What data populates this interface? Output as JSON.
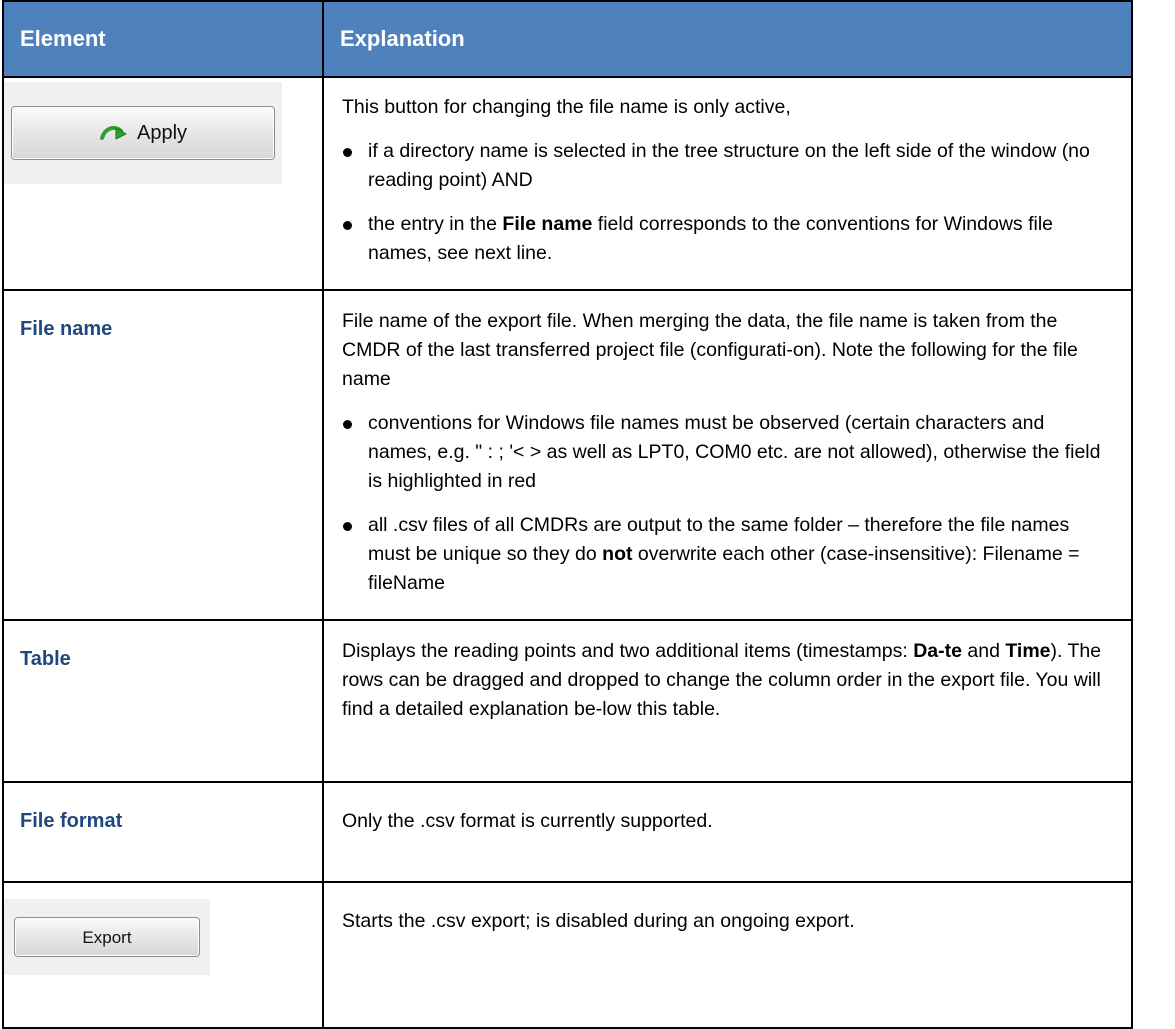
{
  "table": {
    "headers": {
      "element": "Element",
      "explanation": "Explanation"
    },
    "rows": [
      {
        "element_image": {
          "kind": "button",
          "label": "Apply",
          "icon": "green-curved-arrow-icon"
        },
        "intro": "This button for changing the file name is only active,",
        "bullets": [
          {
            "text": "if a directory name is selected in the tree structure on the left side of the window (no reading point) AND"
          },
          {
            "pre": "the entry in the ",
            "bold": "File name",
            "post": " field corresponds to the conventions for Windows file names, see next line."
          }
        ]
      },
      {
        "element": "File name",
        "intro": "File name of the export file. When merging the data, the file name is taken from the CMDR of the last transferred project file (configurati-on). Note the following for the file name",
        "bullets": [
          {
            "text": "conventions for Windows file names must be observed (certain characters and names, e.g. \" : ; '< > as well as LPT0, COM0 etc. are not allowed), otherwise the field is highlighted in red"
          },
          {
            "pre": "all .csv files of all CMDRs are output to the same folder – therefore the file names must be unique so they do ",
            "bold": "not",
            "post": " overwrite each other (case-insensitive): Filename = fileName"
          }
        ]
      },
      {
        "element": "Table",
        "text_pre": "Displays the reading points and two additional items (timestamps: ",
        "bold1": "Da-te",
        "text_mid": " and ",
        "bold2": "Time",
        "text_post": "). The rows can be dragged and dropped to change the column order in the export file. You will find a detailed explanation be-low this table."
      },
      {
        "element": "File format",
        "text": "Only the .csv format is currently supported."
      },
      {
        "element_image": {
          "kind": "button",
          "label": "Export"
        },
        "text": "Starts the .csv export; is disabled during an ongoing export."
      }
    ]
  },
  "colors": {
    "header_bg": "#4f81bd",
    "header_text": "#ffffff",
    "term_text": "#1f497d",
    "arrow_green": "#2e9e2e"
  }
}
